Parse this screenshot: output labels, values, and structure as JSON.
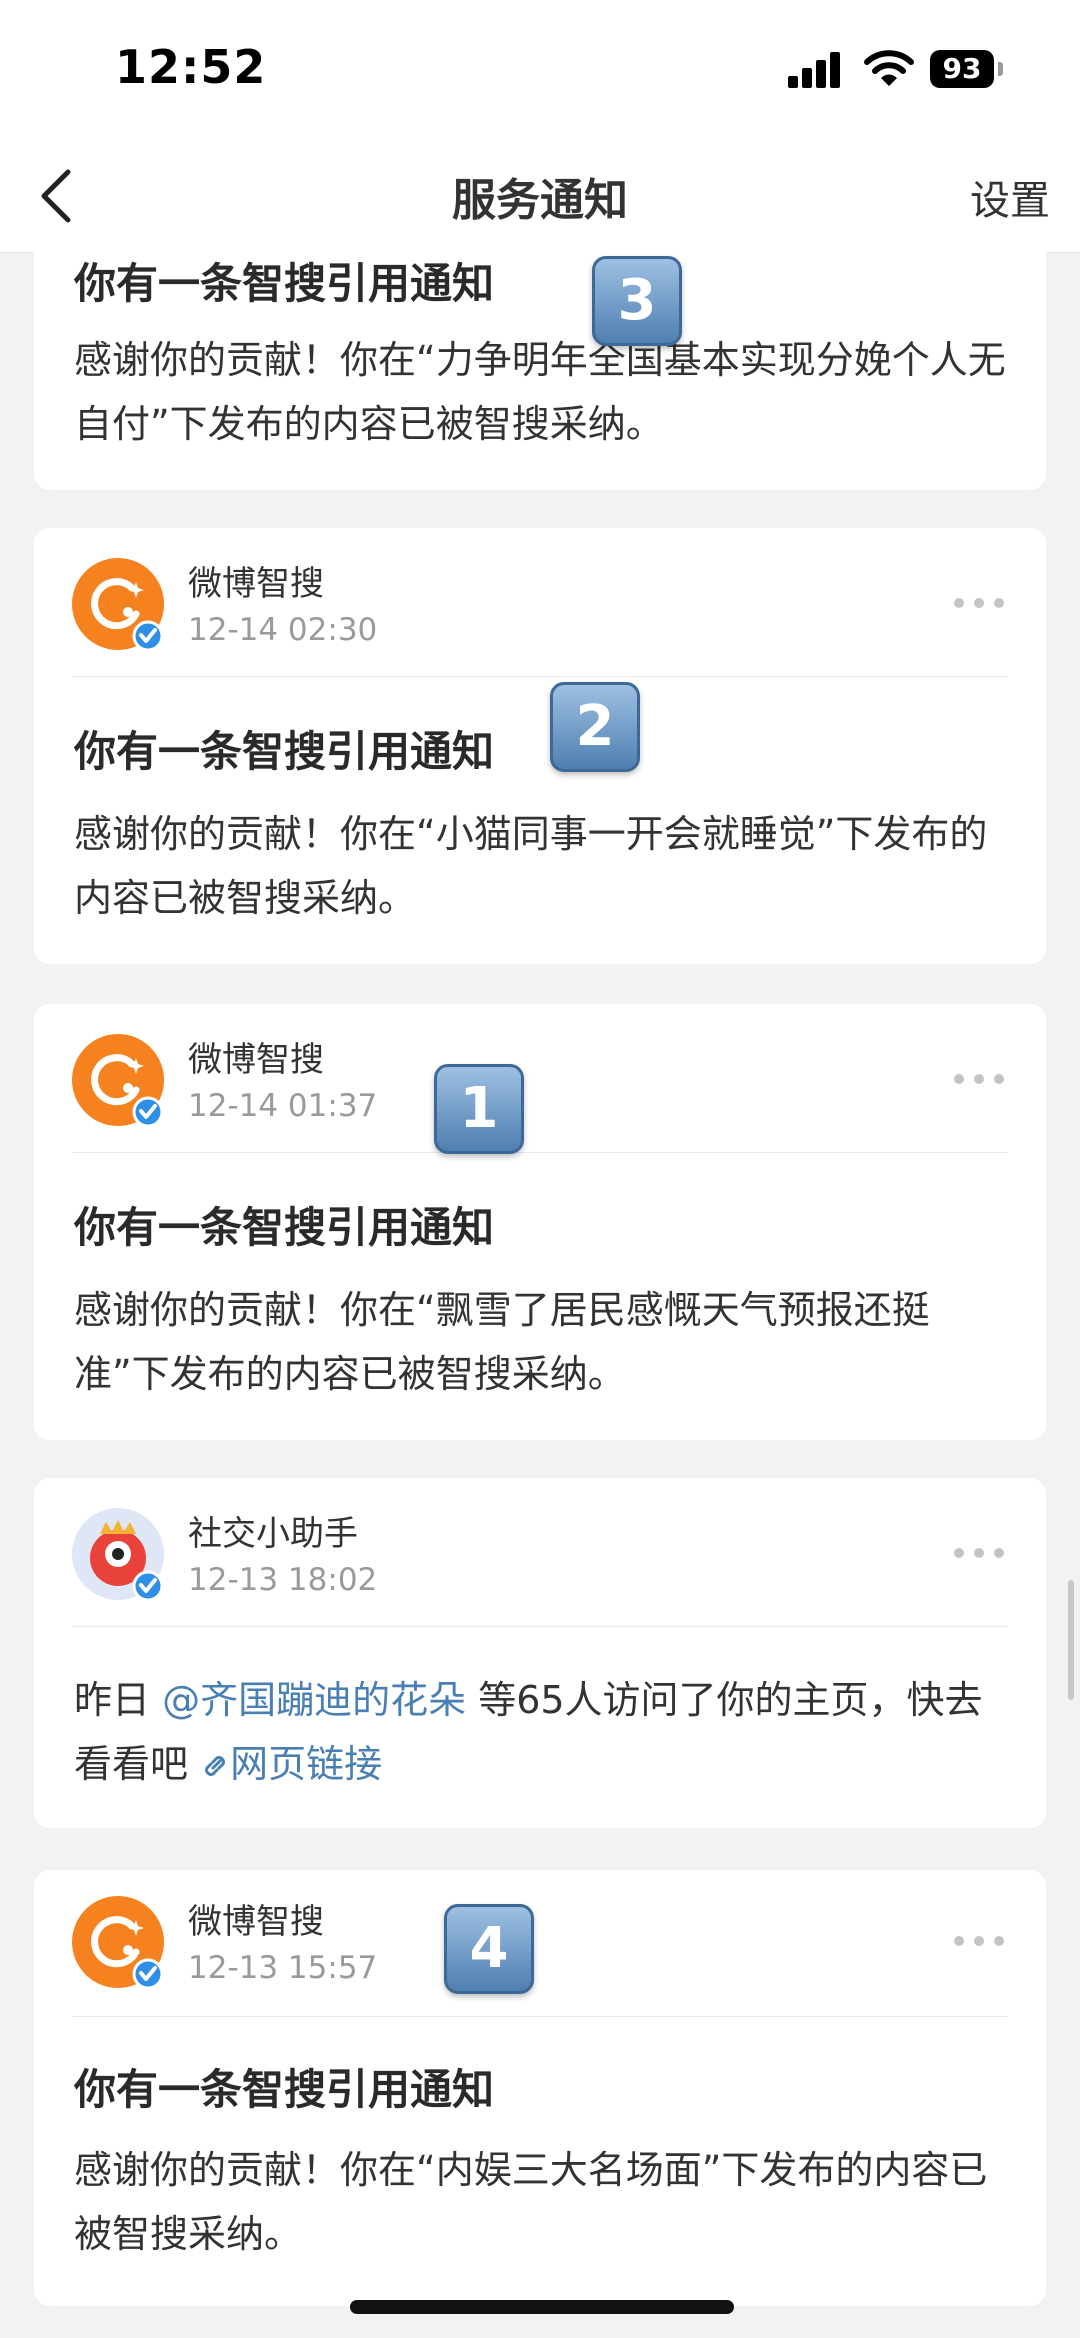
{
  "status_bar": {
    "time": "12:52",
    "battery": "93"
  },
  "nav": {
    "title": "服务通知",
    "settings_label": "设置"
  },
  "cards": [
    {
      "title": "你有一条智搜引用通知",
      "body": "感谢你的贡献！你在“力争明年全国基本实现分娩个人无自付”下发布的内容已被智搜采纳。",
      "badge": "3"
    },
    {
      "sender": "微博智搜",
      "date": "12-14 02:30",
      "title": "你有一条智搜引用通知",
      "body": "感谢你的贡献！你在“小猫同事一开会就睡觉”下发布的内容已被智搜采纳。",
      "badge": "2"
    },
    {
      "sender": "微博智搜",
      "date": "12-14 01:37",
      "title": "你有一条智搜引用通知",
      "body": "感谢你的贡献！你在“飘雪了居民感慨天气预报还挺准”下发布的内容已被智搜采纳。",
      "badge": "1"
    },
    {
      "sender": "社交小助手",
      "date": "12-13 18:02",
      "body_prefix": "昨日 ",
      "mention": "@齐国蹦迪的花朵",
      "body_middle": " 等65人访问了你的主页，快去看看吧 ",
      "link_label": "网页链接"
    },
    {
      "sender": "微博智搜",
      "date": "12-13 15:57",
      "title": "你有一条智搜引用通知",
      "body": "感谢你的贡献！你在“内娱三大名场面”下发布的内容已被智搜采纳。",
      "badge": "4"
    }
  ],
  "colors": {
    "accent_orange": "#f5821f",
    "verified_blue": "#2f8fe6",
    "link_blue": "#4a7fb3"
  }
}
